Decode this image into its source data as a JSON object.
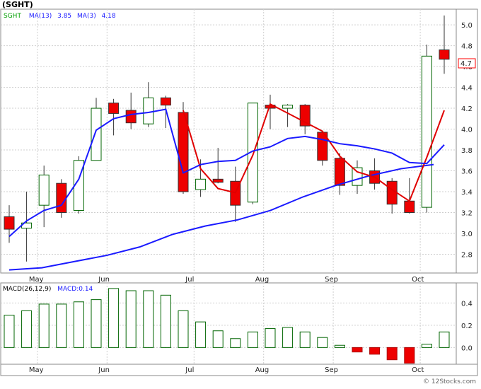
{
  "chart_data": [
    {
      "type": "candlestick",
      "title": "(SGHT)",
      "legend": [
        {
          "text": "SGHT",
          "color": "#00a000"
        },
        {
          "text": "MA(13)",
          "color": "#1a1aff"
        },
        {
          "text": "3.85",
          "color": "#1a1aff"
        },
        {
          "text": "MA(3)",
          "color": "#1a1aff"
        },
        {
          "text": "4.18",
          "color": "#1a1aff"
        }
      ],
      "months": [
        "May",
        "Jun",
        "Jul",
        "Aug",
        "Sep",
        "Oct"
      ],
      "yticks": [
        "2.8",
        "3.0",
        "3.2",
        "3.4",
        "3.6",
        "3.8",
        "4.0",
        "4.2",
        "4.4",
        "4.6",
        "4.8",
        "5.0"
      ],
      "ylim": [
        2.62,
        5.15
      ],
      "last_price": "4.7",
      "grid": true,
      "candles": [
        {
          "open": 3.16,
          "high": 3.27,
          "low": 2.91,
          "close": 3.04,
          "up": false
        },
        {
          "open": 3.05,
          "high": 3.4,
          "low": 2.73,
          "close": 3.1,
          "up": true
        },
        {
          "open": 3.27,
          "high": 3.65,
          "low": 3.06,
          "close": 3.56,
          "up": true
        },
        {
          "open": 3.48,
          "high": 3.52,
          "low": 3.15,
          "close": 3.2,
          "up": false
        },
        {
          "open": 3.22,
          "high": 3.74,
          "low": 3.19,
          "close": 3.7,
          "up": true
        },
        {
          "open": 3.7,
          "high": 4.3,
          "low": 3.7,
          "close": 4.2,
          "up": true
        },
        {
          "open": 4.25,
          "high": 4.29,
          "low": 3.94,
          "close": 4.15,
          "up": false
        },
        {
          "open": 4.18,
          "high": 4.35,
          "low": 4.0,
          "close": 4.06,
          "up": false
        },
        {
          "open": 4.05,
          "high": 4.45,
          "low": 4.02,
          "close": 4.3,
          "up": true
        },
        {
          "open": 4.3,
          "high": 4.32,
          "low": 4.01,
          "close": 4.23,
          "up": false
        },
        {
          "open": 4.16,
          "high": 4.26,
          "low": 3.38,
          "close": 3.4,
          "up": false
        },
        {
          "open": 3.42,
          "high": 3.71,
          "low": 3.35,
          "close": 3.52,
          "up": true
        },
        {
          "open": 3.52,
          "high": 3.82,
          "low": 3.48,
          "close": 3.49,
          "up": false
        },
        {
          "open": 3.5,
          "high": 3.64,
          "low": 3.11,
          "close": 3.27,
          "up": false
        },
        {
          "open": 3.3,
          "high": 4.25,
          "low": 3.28,
          "close": 4.25,
          "up": true
        },
        {
          "open": 4.23,
          "high": 4.33,
          "low": 4.0,
          "close": 4.2,
          "up": false
        },
        {
          "open": 4.2,
          "high": 4.24,
          "low": 4.02,
          "close": 4.23,
          "up": true
        },
        {
          "open": 4.23,
          "high": 4.24,
          "low": 3.95,
          "close": 4.03,
          "up": false
        },
        {
          "open": 3.97,
          "high": 3.97,
          "low": 3.65,
          "close": 3.7,
          "up": false
        },
        {
          "open": 3.72,
          "high": 3.77,
          "low": 3.37,
          "close": 3.46,
          "up": false
        },
        {
          "open": 3.46,
          "high": 3.7,
          "low": 3.38,
          "close": 3.63,
          "up": true
        },
        {
          "open": 3.6,
          "high": 3.72,
          "low": 3.42,
          "close": 3.48,
          "up": false
        },
        {
          "open": 3.5,
          "high": 3.53,
          "low": 3.19,
          "close": 3.28,
          "up": false
        },
        {
          "open": 3.31,
          "high": 3.53,
          "low": 3.19,
          "close": 3.2,
          "up": false
        },
        {
          "open": 3.25,
          "high": 4.81,
          "low": 3.2,
          "close": 4.7,
          "up": true
        },
        {
          "open": 4.76,
          "high": 5.09,
          "low": 4.53,
          "close": 4.67,
          "up": false
        }
      ],
      "ma3": [
        null,
        null,
        null,
        null,
        null,
        null,
        null,
        null,
        null,
        null,
        4.18,
        3.62,
        3.43,
        3.39,
        3.75,
        4.24,
        null,
        null,
        3.98,
        3.74,
        3.59,
        3.54,
        3.42,
        3.31,
        3.73,
        4.18
      ],
      "ma13": [
        2.97,
        3.12,
        3.22,
        3.27,
        3.52,
        3.99,
        4.1,
        4.14,
        4.16,
        4.19,
        3.58,
        3.66,
        3.69,
        3.7,
        3.79,
        3.83,
        3.91,
        3.93,
        3.9,
        3.86,
        3.84,
        3.81,
        3.77,
        3.68,
        3.67,
        3.85
      ]
    },
    {
      "type": "line",
      "series": [
        {
          "values": [
            2.65,
            2.67,
            2.73,
            2.79,
            2.87,
            2.99,
            3.07,
            3.13,
            3.22,
            3.35,
            3.46,
            3.55,
            3.62,
            3.66
          ]
        }
      ]
    },
    {
      "type": "bar",
      "title": "MACD(26,12,9)",
      "legend_value": "MACD:0.14",
      "values": [
        0.29,
        0.33,
        0.39,
        0.39,
        0.41,
        0.43,
        0.53,
        0.51,
        0.51,
        0.47,
        0.33,
        0.23,
        0.15,
        0.08,
        0.14,
        0.17,
        0.18,
        0.14,
        0.09,
        0.02,
        -0.04,
        -0.06,
        -0.11,
        -0.14,
        0.03,
        0.14
      ],
      "yticks": [
        "0.0",
        "0.2",
        "0.4"
      ],
      "ylim": [
        -0.15,
        0.58
      ]
    }
  ],
  "watermark": "© 12Stocks.com"
}
